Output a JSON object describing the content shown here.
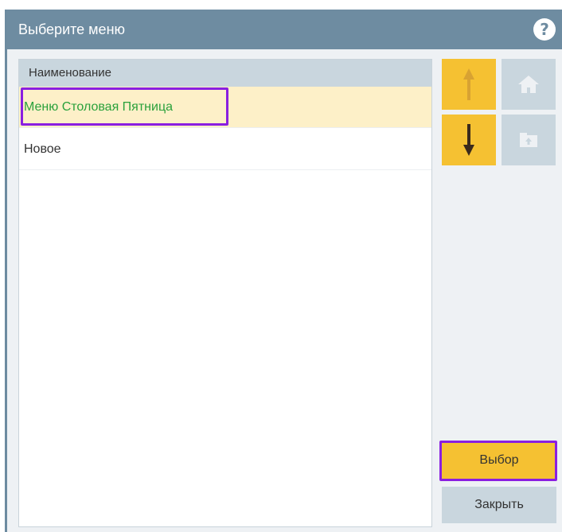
{
  "dialog": {
    "title": "Выберите меню",
    "help_icon": "question-circle-icon",
    "help_glyph": "?"
  },
  "list": {
    "column_header": "Наименование",
    "rows": [
      {
        "label": "Меню Столовая Пятница",
        "selected": true
      },
      {
        "label": "Новое",
        "selected": false
      }
    ]
  },
  "nav": {
    "up_icon": "arrow-up-icon",
    "down_icon": "arrow-down-icon",
    "home_icon": "home-icon",
    "folder_up_icon": "folder-up-icon"
  },
  "actions": {
    "select_label": "Выбор",
    "close_label": "Закрыть"
  },
  "colors": {
    "titlebar": "#6e8ca1",
    "accent_yellow": "#f5c132",
    "grey_button": "#c9d6de",
    "selected_row": "#fdf0c8",
    "selected_text": "#2aa13c",
    "highlight_frame": "#8a1fe0"
  }
}
